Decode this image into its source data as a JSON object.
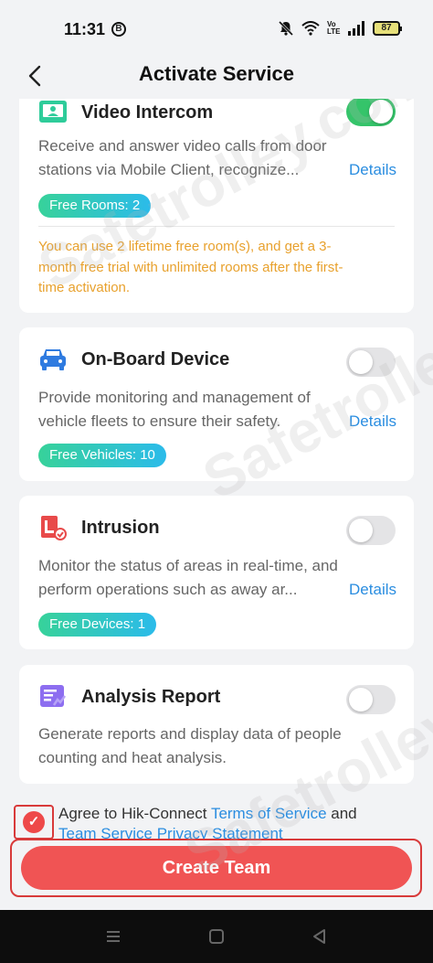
{
  "status_bar": {
    "time": "11:31",
    "b_badge": "B",
    "volte": "Vo LTE",
    "battery": "87"
  },
  "header": {
    "title": "Activate Service"
  },
  "cards": [
    {
      "title": "Video Intercom",
      "toggle_on": true,
      "desc_line1": "Receive and answer video calls from door",
      "desc_line2": "stations via Mobile Client, recognize...",
      "details": "Details",
      "badge": "Free Rooms: 2",
      "promo_line1": "You can use 2 lifetime free room(s), and get a 3-",
      "promo_line2": "month free trial with unlimited rooms after the first-",
      "promo_line3": "time activation."
    },
    {
      "title": "On-Board Device",
      "toggle_on": false,
      "desc_line1": "Provide monitoring and management of",
      "desc_line2": "vehicle fleets to ensure their safety.",
      "details": "Details",
      "badge": "Free Vehicles: 10"
    },
    {
      "title": "Intrusion",
      "toggle_on": false,
      "desc_line1": "Monitor the status of areas in real-time, and",
      "desc_line2": "perform operations such as away ar...",
      "details": "Details",
      "badge": "Free Devices: 1"
    },
    {
      "title": "Analysis Report",
      "toggle_on": false,
      "desc_line1": "Generate reports and display data of people",
      "desc_line2": "counting and heat analysis."
    }
  ],
  "agreement": {
    "checked": true,
    "prefix": "Agree to Hik-Connect ",
    "terms_link": "Terms of Service",
    "and": " and",
    "privacy_link": "Team Service Privacy Statement"
  },
  "cta": {
    "label": "Create Team"
  },
  "watermark": "Safetrolley.com",
  "colors": {
    "accent_link": "#2a8de0",
    "toggle_on": "#35c46a",
    "cta": "#f05454",
    "promo": "#e8a12d"
  }
}
